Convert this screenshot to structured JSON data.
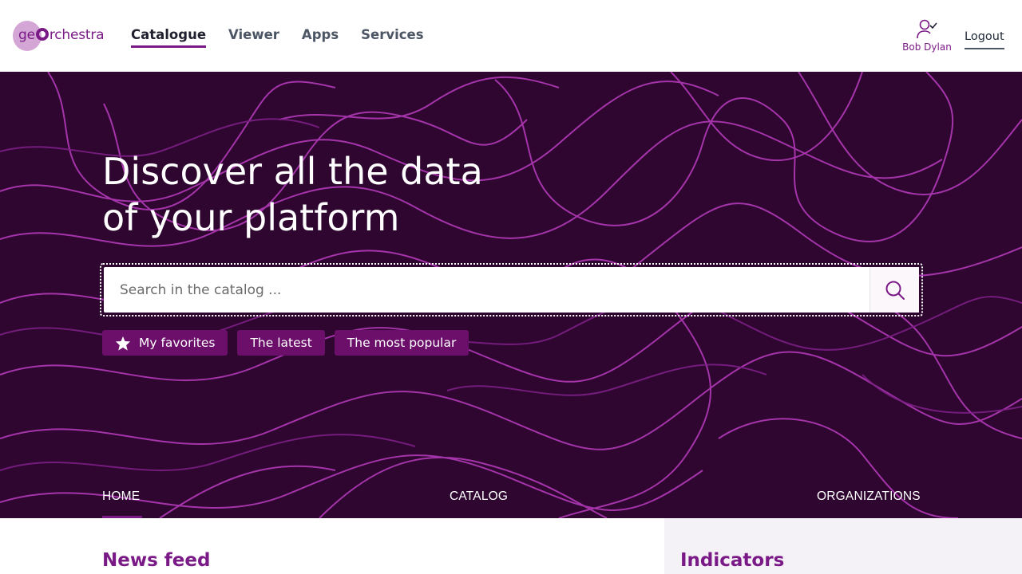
{
  "app": {
    "logo_text_pre": "ge",
    "logo_text_post": "rchestra"
  },
  "nav": {
    "items": [
      {
        "label": "Catalogue",
        "active": true
      },
      {
        "label": "Viewer",
        "active": false
      },
      {
        "label": "Apps",
        "active": false
      },
      {
        "label": "Services",
        "active": false
      }
    ]
  },
  "user": {
    "name": "Bob Dylan",
    "icon": "user-check-icon",
    "logout_label": "Logout"
  },
  "hero": {
    "title": "Discover all the data\nof your platform",
    "search": {
      "placeholder": "Search in the catalog ...",
      "value": "",
      "button_icon": "search-icon"
    },
    "chips": [
      {
        "label": "My favorites",
        "icon": "star-icon"
      },
      {
        "label": "The latest"
      },
      {
        "label": "The most popular"
      }
    ],
    "tabs": [
      {
        "label": "HOME",
        "active": true
      },
      {
        "label": "CATALOG",
        "active": false
      },
      {
        "label": "ORGANIZATIONS",
        "active": false
      }
    ]
  },
  "sections": {
    "news_title": "News feed",
    "indicators_title": "Indicators"
  },
  "colors": {
    "brand": "#7a1a86",
    "hero_bg": "#2e0630",
    "chip_bg": "#6b0f6b",
    "contour_lines": "#b23ab8",
    "indicators_bg": "#f4f1f7"
  }
}
